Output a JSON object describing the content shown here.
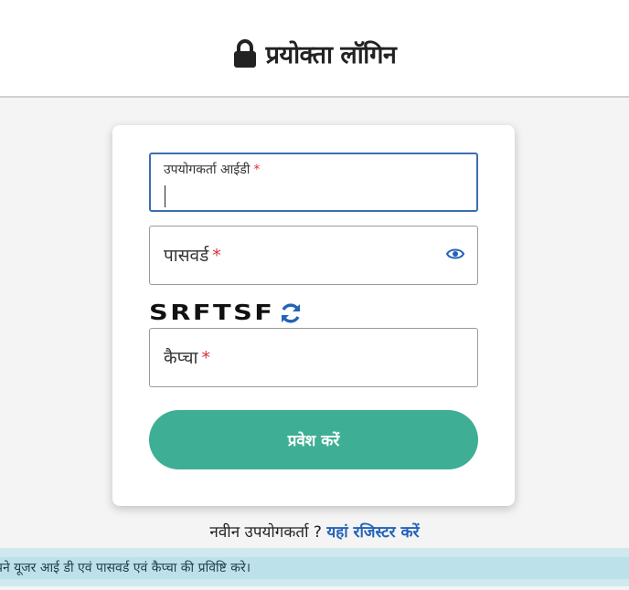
{
  "header": {
    "title": "प्रयोक्ता लॉगिन",
    "icon": "lock-icon"
  },
  "form": {
    "userid": {
      "label": "उपयोगकर्ता आईडी",
      "required_mark": "*",
      "value": ""
    },
    "password": {
      "label": "पासवर्ड",
      "required_mark": "*",
      "value": "",
      "toggle_icon": "eye-icon"
    },
    "captcha": {
      "code": "SRFTSF",
      "refresh_icon": "refresh-icon"
    },
    "captcha_input": {
      "label": "कैप्चा",
      "required_mark": "*",
      "value": ""
    },
    "submit_label": "प्रवेश करें"
  },
  "register": {
    "prompt": "नवीन उपयोगकर्ता ?",
    "link_label": "यहां रजिस्टर करें"
  },
  "notice": {
    "text": "तर्गत अपने यूजर आई डी एवं पासवर्ड एवं कैप्चा की प्रविष्टि करे।"
  },
  "colors": {
    "accent": "#3eaf94",
    "link": "#2463b8",
    "required": "#d8303b",
    "focus": "#3a6fb0",
    "notice_bg": "#cfe9ef"
  }
}
